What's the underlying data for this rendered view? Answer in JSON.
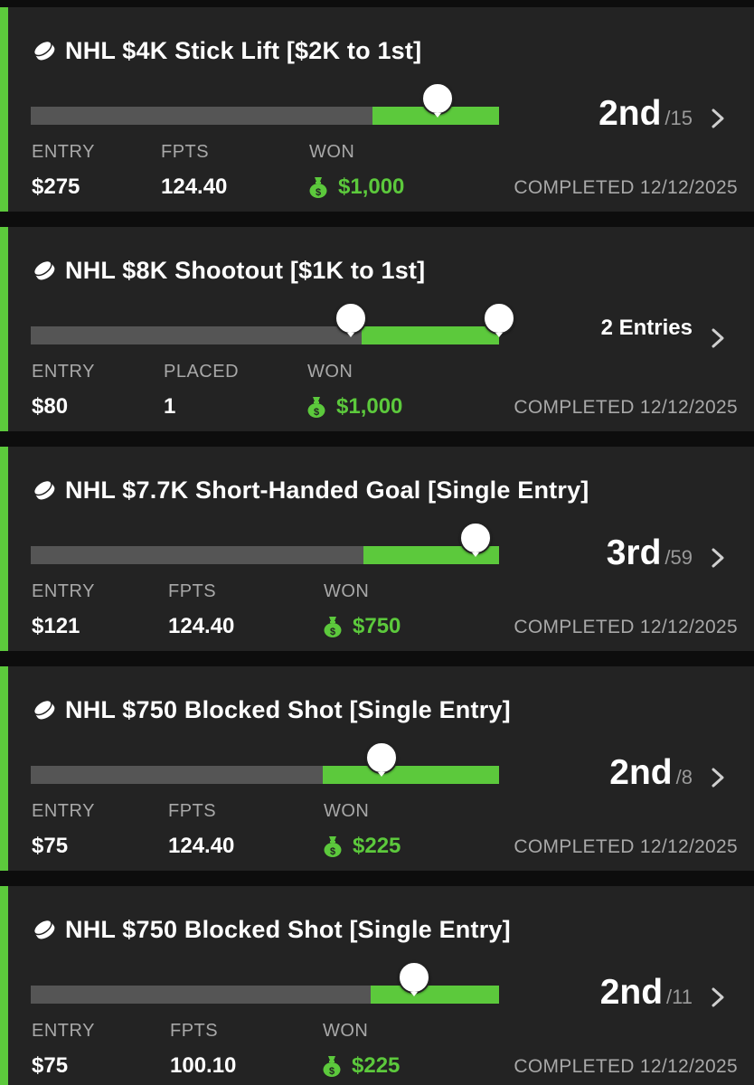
{
  "colors": {
    "accent": "#5cc93c",
    "card": "#232323",
    "track": "#555555",
    "label": "#a8a8a8"
  },
  "contests": [
    {
      "title": "NHL $4K Stick Lift [$2K to 1st]",
      "rank_place": "2nd",
      "rank_total": "/15",
      "entries_text": "",
      "col1_label": "ENTRY",
      "col1_value": "$275",
      "col2_label": "FPTS",
      "col2_value": "124.40",
      "won_label": "WON",
      "won_value": "$1,000",
      "completed": "COMPLETED 12/12/2025"
    },
    {
      "title": "NHL $8K Shootout [$1K to 1st]",
      "rank_place": "",
      "rank_total": "",
      "entries_text": "2 Entries",
      "col1_label": "ENTRY",
      "col1_value": "$80",
      "col2_label": "PLACED",
      "col2_value": "1",
      "won_label": "WON",
      "won_value": "$1,000",
      "completed": "COMPLETED 12/12/2025"
    },
    {
      "title": "NHL $7.7K Short-Handed Goal [Single Entry]",
      "rank_place": "3rd",
      "rank_total": "/59",
      "entries_text": "",
      "col1_label": "ENTRY",
      "col1_value": "$121",
      "col2_label": "FPTS",
      "col2_value": "124.40",
      "won_label": "WON",
      "won_value": "$750",
      "completed": "COMPLETED 12/12/2025"
    },
    {
      "title": "NHL $750 Blocked Shot [Single Entry]",
      "rank_place": "2nd",
      "rank_total": "/8",
      "entries_text": "",
      "col1_label": "ENTRY",
      "col1_value": "$75",
      "col2_label": "FPTS",
      "col2_value": "124.40",
      "won_label": "WON",
      "won_value": "$225",
      "completed": "COMPLETED 12/12/2025"
    },
    {
      "title": "NHL $750 Blocked Shot [Single Entry]",
      "rank_place": "2nd",
      "rank_total": "/11",
      "entries_text": "",
      "col1_label": "ENTRY",
      "col1_value": "$75",
      "col2_label": "FPTS",
      "col2_value": "100.10",
      "won_label": "WON",
      "won_value": "$225",
      "completed": "COMPLETED 12/12/2025"
    }
  ]
}
